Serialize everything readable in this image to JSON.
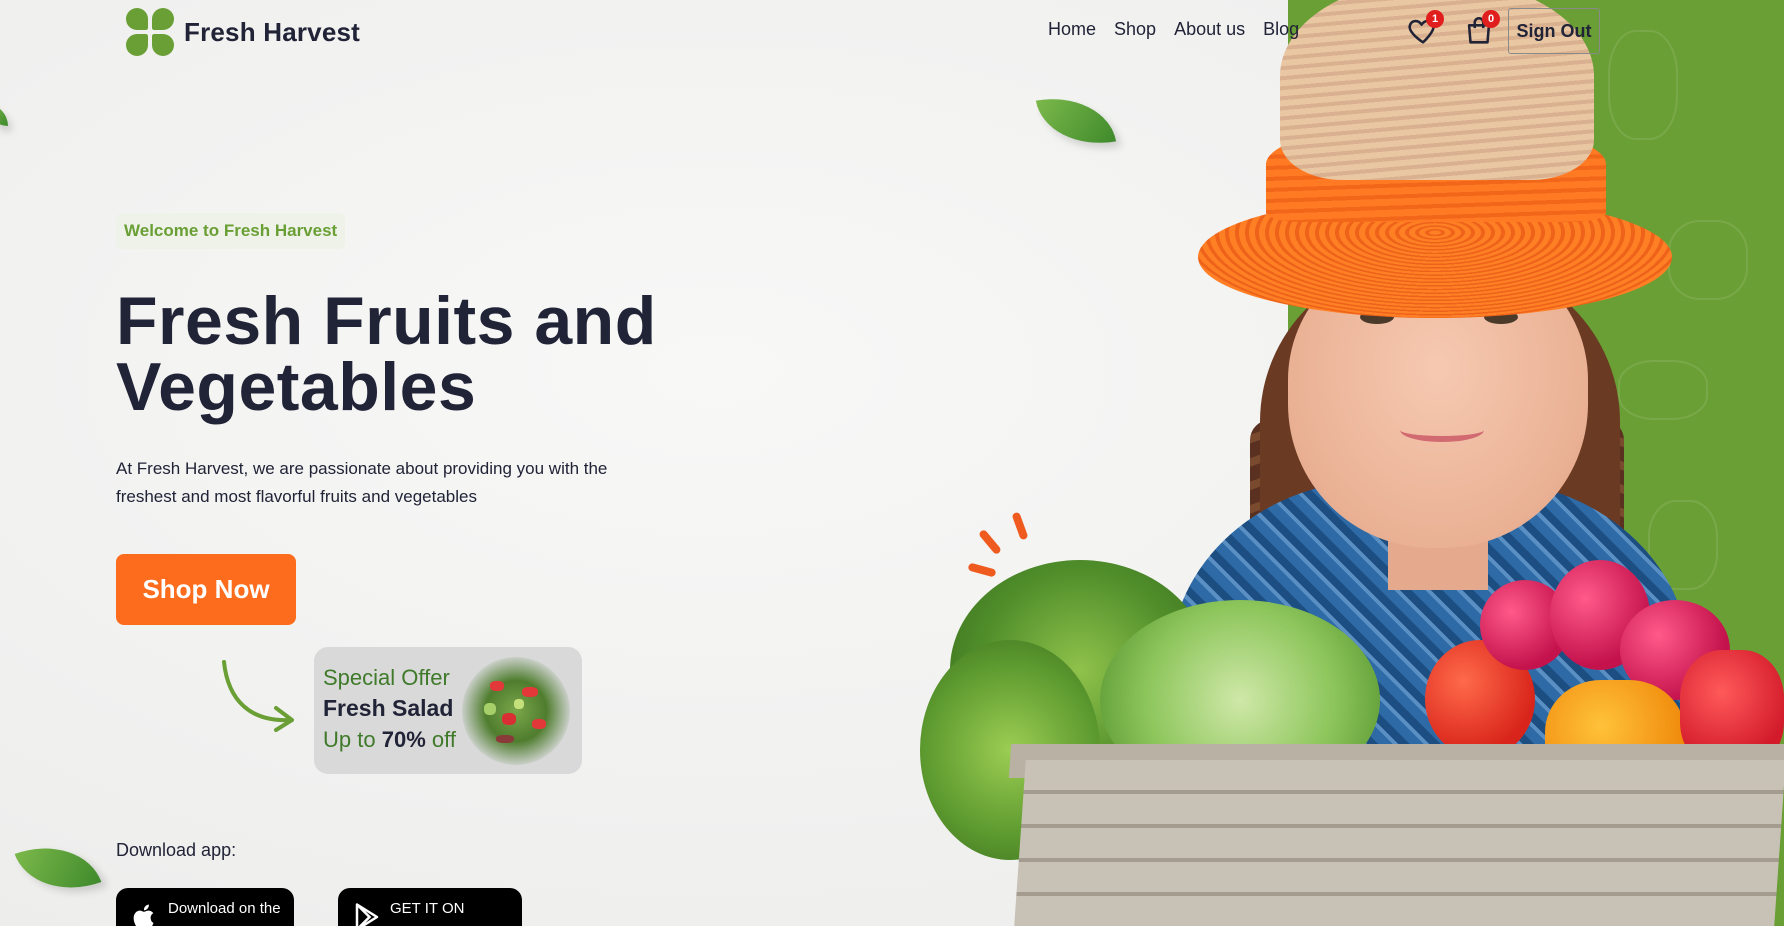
{
  "brand": {
    "name": "Fresh Harvest",
    "accent": "#6a9f35",
    "cta": "#fd6b1c"
  },
  "nav": {
    "items": [
      {
        "label": "Home"
      },
      {
        "label": "Shop"
      },
      {
        "label": "About us"
      },
      {
        "label": "Blog"
      }
    ]
  },
  "header": {
    "wishlist": {
      "icon": "heart-icon",
      "count": "1"
    },
    "cart": {
      "icon": "shopping-bag-icon",
      "count": "0"
    },
    "signout_label": "Sign Out"
  },
  "hero": {
    "welcome": "Welcome to Fresh Harvest",
    "title_line1": "Fresh Fruits and",
    "title_line2": "Vegetables",
    "description": "At Fresh Harvest, we are passionate about providing you with the freshest and most flavorful fruits and vegetables",
    "cta_label": "Shop Now"
  },
  "offer": {
    "label": "Special Offer",
    "product": "Fresh Salad",
    "discount_prefix": "Up to",
    "discount_value": "70%",
    "discount_suffix": "off"
  },
  "download": {
    "label": "Download app:",
    "app_store_small": "Download on the",
    "play_store_small": "GET IT ON"
  }
}
